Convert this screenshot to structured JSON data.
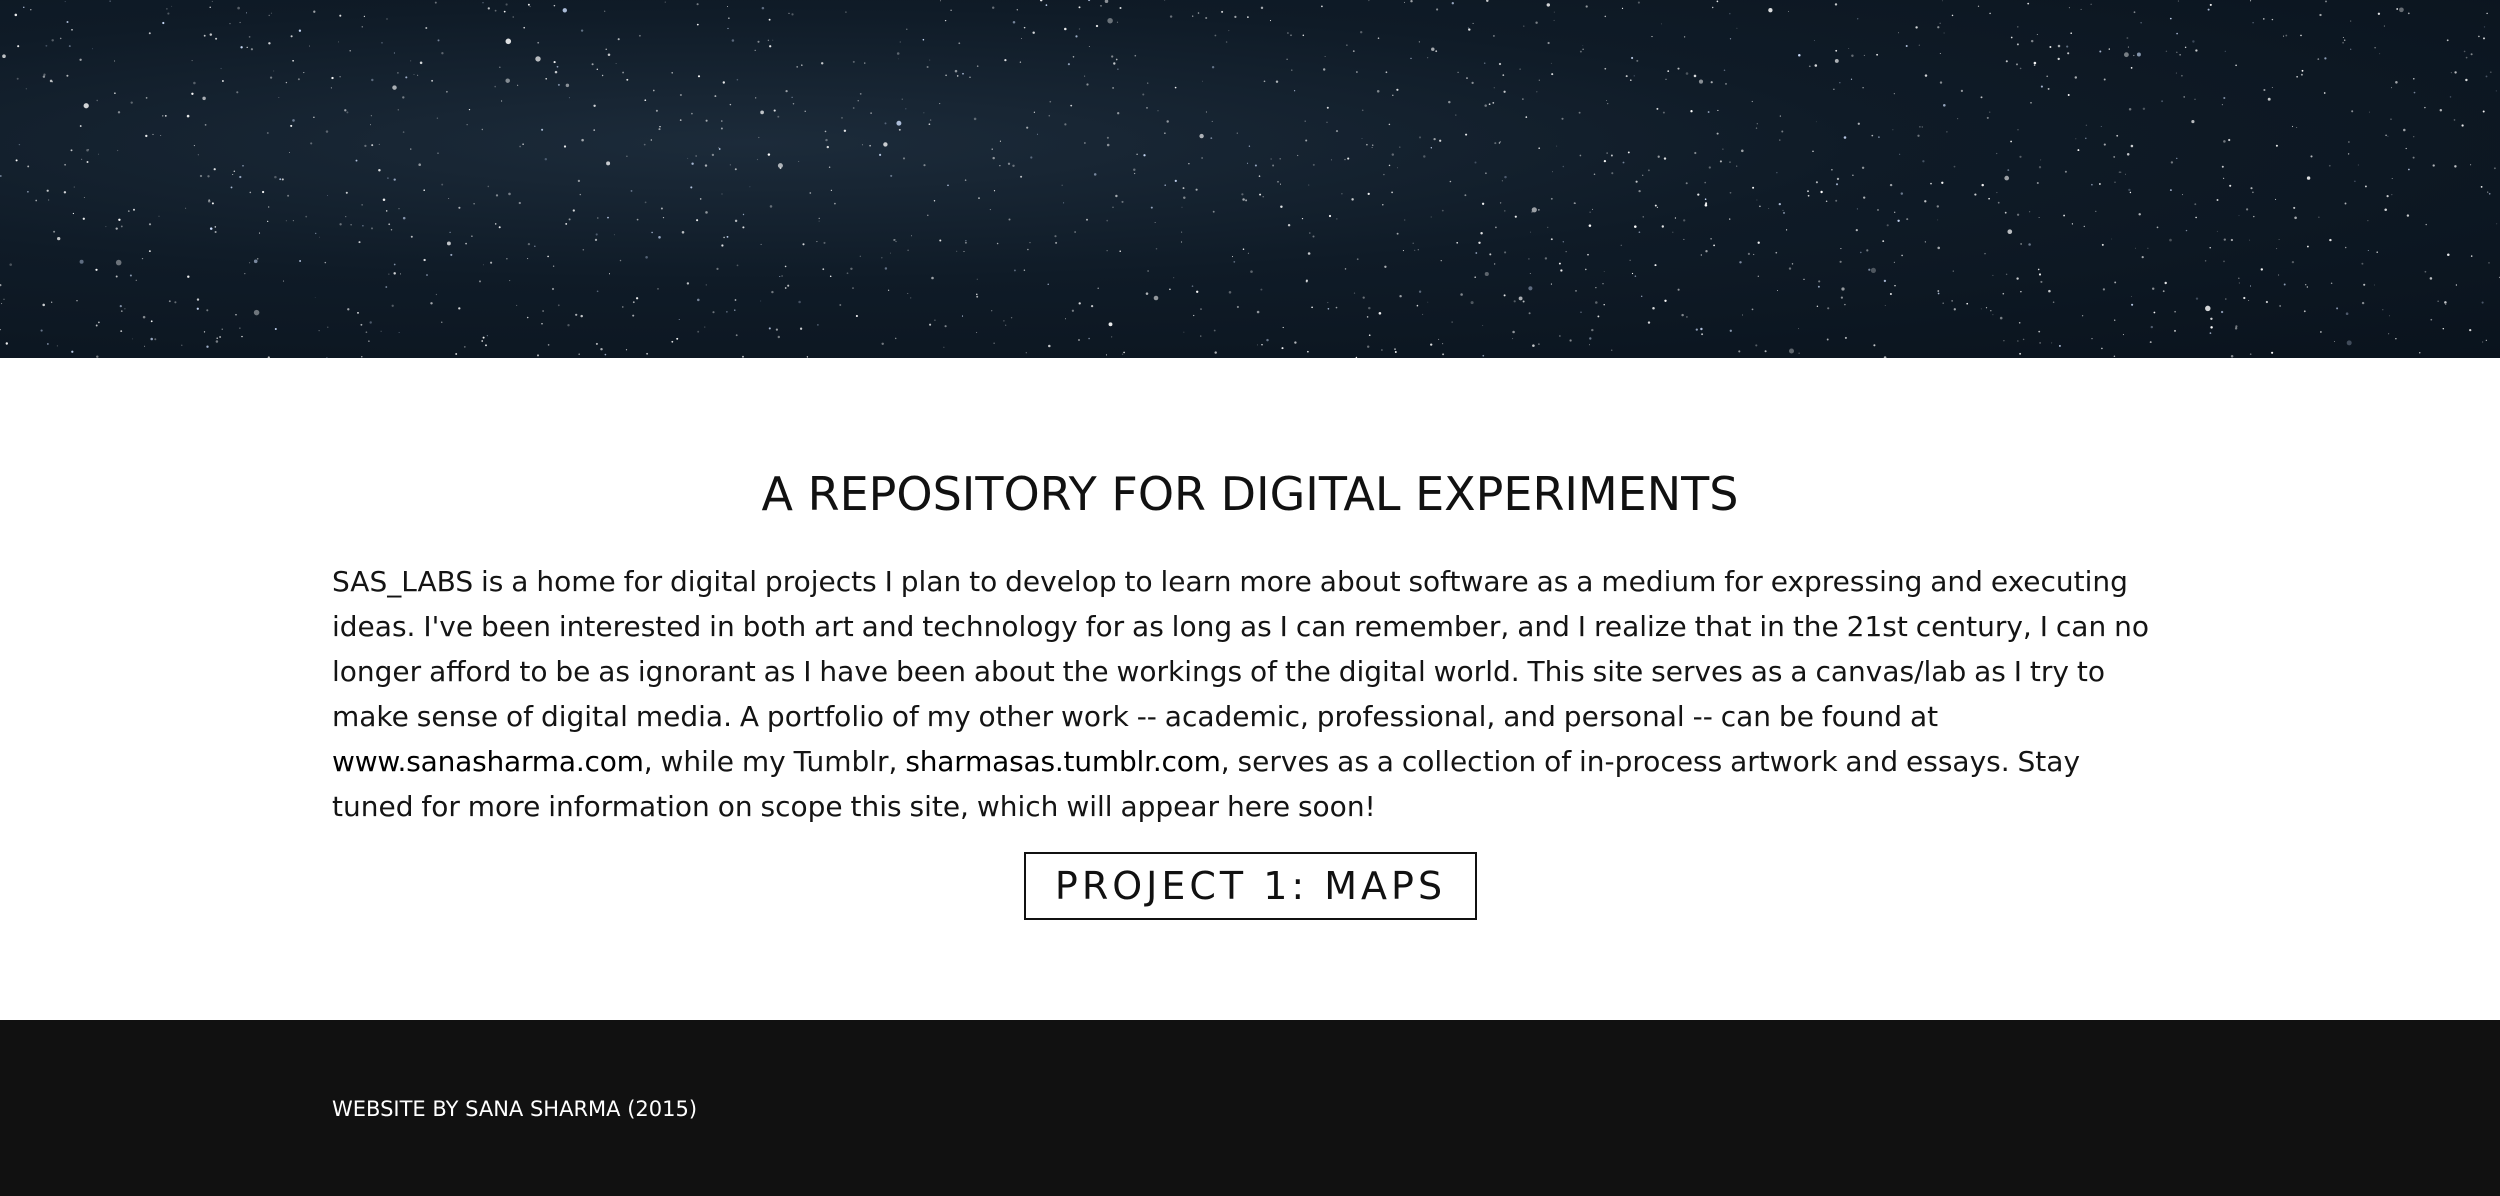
{
  "hero": {
    "image": "starry-night-sky"
  },
  "main": {
    "title": "A REPOSITORY FOR DIGITAL EXPERIMENTS",
    "intro": {
      "text_before_link1": "SAS_LABS is a home for digital projects I plan to develop to learn more about software as a medium for expressing and executing ideas. I've been interested in both art and technology for as long as I can remember, and I realize that in the 21st century, I can no longer afford to be as ignorant as I have been about the workings of the digital world. This site serves as a canvas/lab as I try to make sense of digital media. A portfolio of my other work -- academic, professional, and personal -- can be found at ",
      "link1": "www.sanasharma.com",
      "text_between_links": ", while my Tumblr, ",
      "link2": "sharmasas.tumblr.com",
      "text_after_link2": ", serves as a collection of in-process artwork and essays. Stay tuned for more information on scope this site, which will appear here soon!"
    },
    "project_button_label": "PROJECT 1: MAPS"
  },
  "footer": {
    "credit": "WEBSITE BY SANA SHARMA (2015)"
  },
  "colors": {
    "hero_bg": "#0f1b27",
    "footer_bg": "#111111",
    "text": "#141414"
  }
}
